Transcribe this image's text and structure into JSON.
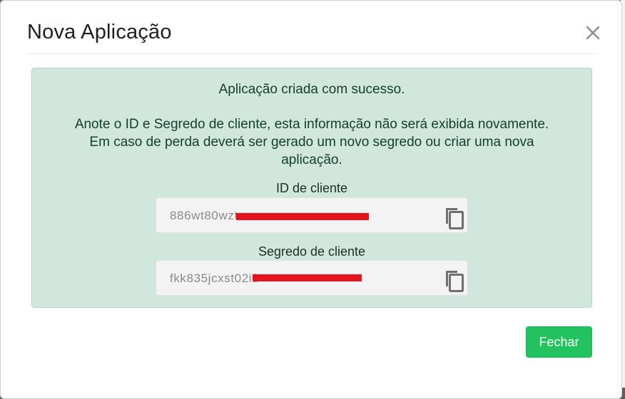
{
  "modal": {
    "title": "Nova Aplicação",
    "close_icon": "close-icon"
  },
  "alert": {
    "line1": "Aplicação criada com sucesso.",
    "line2": "Anote o ID e Segredo de cliente, esta informação não será exibida novamente.",
    "line3": "Em caso de perda deverá ser gerado um novo segredo ou criar uma nova",
    "line4": "aplicação.",
    "background": "#d1e7dd"
  },
  "client_id": {
    "label": "ID de cliente",
    "value": "886wt80wzt",
    "copy_icon": "copy-icon"
  },
  "client_secret": {
    "label": "Segredo de cliente",
    "value": "fkk835jcxst02i3",
    "copy_icon": "copy-icon"
  },
  "footer": {
    "close_label": "Fechar",
    "button_color": "#22c25e"
  },
  "colors": {
    "redaction": "#e3141c"
  }
}
